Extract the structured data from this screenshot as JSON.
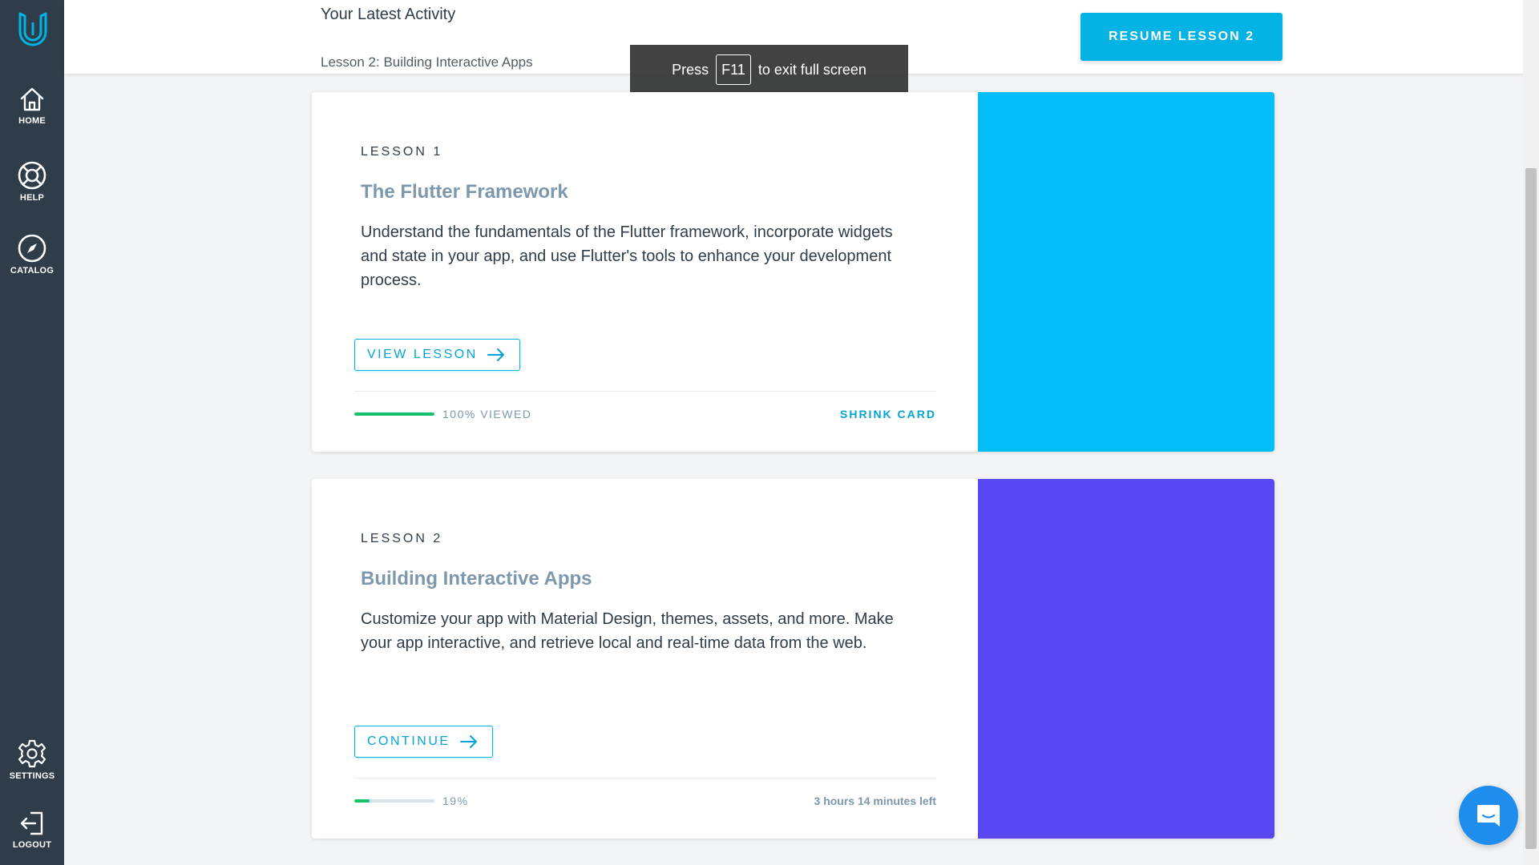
{
  "sidebar": {
    "logo_icon": "udacity-logo-icon",
    "items": [
      {
        "label": "HOME",
        "icon": "home-icon"
      },
      {
        "label": "HELP",
        "icon": "lifebuoy-icon"
      },
      {
        "label": "CATALOG",
        "icon": "compass-icon"
      },
      {
        "label": "SETTINGS",
        "icon": "gear-icon"
      },
      {
        "label": "LOGOUT",
        "icon": "logout-icon"
      }
    ]
  },
  "header": {
    "title": "Your Latest Activity",
    "subtitle": "Lesson 2: Building Interactive Apps",
    "resume_label": "RESUME LESSON 2"
  },
  "fullscreen_toast": {
    "before": "Press",
    "key": "F11",
    "after": "to exit full screen"
  },
  "lessons": [
    {
      "number_label": "LESSON 1",
      "title": "The Flutter Framework",
      "description": "Understand the fundamentals of the Flutter framework, incorporate widgets and state in your app, and use Flutter's tools to enhance your development process.",
      "button_label": "VIEW LESSON",
      "progress": 1.0,
      "progress_text": "100% VIEWED",
      "right_text": "SHRINK CARD",
      "panel_color": "#02bdf6"
    },
    {
      "number_label": "LESSON 2",
      "title": "Building Interactive Apps",
      "description": "Customize your app with Material Design, themes, assets, and more. Make your app interactive, and retrieve local and real-time data from the web.",
      "button_label": "CONTINUE",
      "progress": 0.19,
      "progress_text": "19%",
      "right_text": "3 hours 14 minutes left",
      "panel_color": "#5a48f3"
    }
  ],
  "colors": {
    "accent": "#02b3e4",
    "sidebar_bg": "#2e3d49",
    "progress_green": "#15c26b",
    "chat_blue": "#1f8ded"
  },
  "chat": {
    "icon": "chat-bubble-icon"
  }
}
